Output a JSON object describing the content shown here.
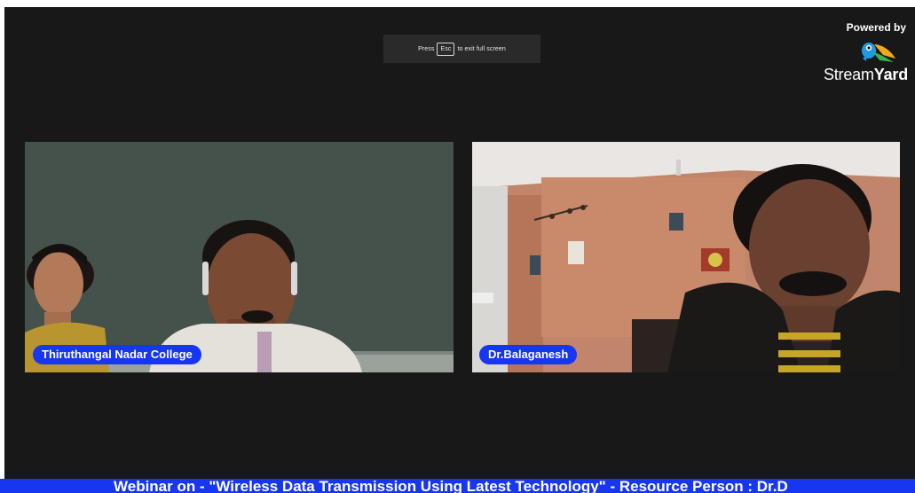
{
  "fullscreen_hint": {
    "press": "Press",
    "key": "Esc",
    "suffix": "to exit full screen"
  },
  "branding": {
    "powered_by": "Powered by",
    "name_light": "Stream",
    "name_bold": "Yard",
    "logo_icon": "streamyard-bird-logo-icon"
  },
  "participants": [
    {
      "name": "Thiruthangal Nadar College"
    },
    {
      "name": "Dr.Balaganesh"
    }
  ],
  "ticker": {
    "text": "Webinar on - \"Wireless Data Transmission Using Latest Technology\" - Resource Person : Dr.D"
  },
  "colors": {
    "background": "#181818",
    "accent_blue": "#1736f0",
    "text_white": "#ffffff"
  }
}
